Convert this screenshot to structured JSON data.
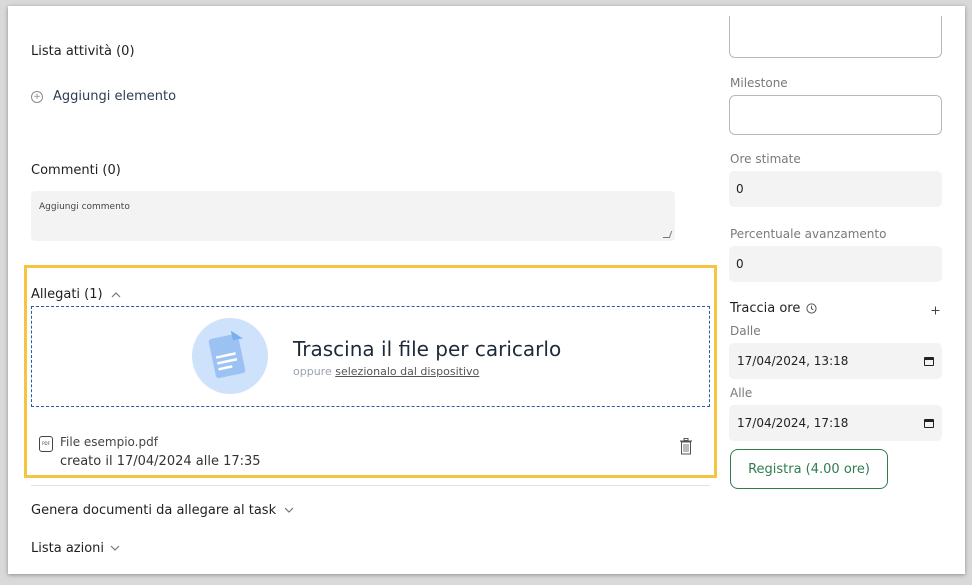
{
  "left": {
    "activities": {
      "title": "Lista attività (0)",
      "add_label": "Aggiungi elemento"
    },
    "comments": {
      "title": "Commenti (0)",
      "placeholder": "Aggiungi commento"
    },
    "attachments": {
      "title": "Allegati (1)",
      "drop_title": "Trascina il file per caricarlo",
      "drop_prefix": "oppure",
      "drop_link": "selezionalo dal dispositivo",
      "file": {
        "name": "File esempio.pdf",
        "created": "creato il 17/04/2024 alle 17:35",
        "type_badge": "PDF"
      }
    },
    "generate_docs": "Genera documenti da allegare al task",
    "actions_list": "Lista azioni"
  },
  "right": {
    "milestone_label": "Milestone",
    "estimated_hours": {
      "label": "Ore stimate",
      "value": "0"
    },
    "progress": {
      "label": "Percentuale avanzamento",
      "value": "0"
    },
    "track": {
      "title": "Traccia ore",
      "from_label": "Dalle",
      "from_value": "17/04/2024, 13:18",
      "to_label": "Alle",
      "to_value": "17/04/2024, 17:18",
      "register_button": "Registra (4.00 ore)"
    }
  },
  "colors": {
    "highlight": "#f5c542",
    "accent_green": "#2f7d4f",
    "dropzone_border": "#2a5aa8"
  }
}
